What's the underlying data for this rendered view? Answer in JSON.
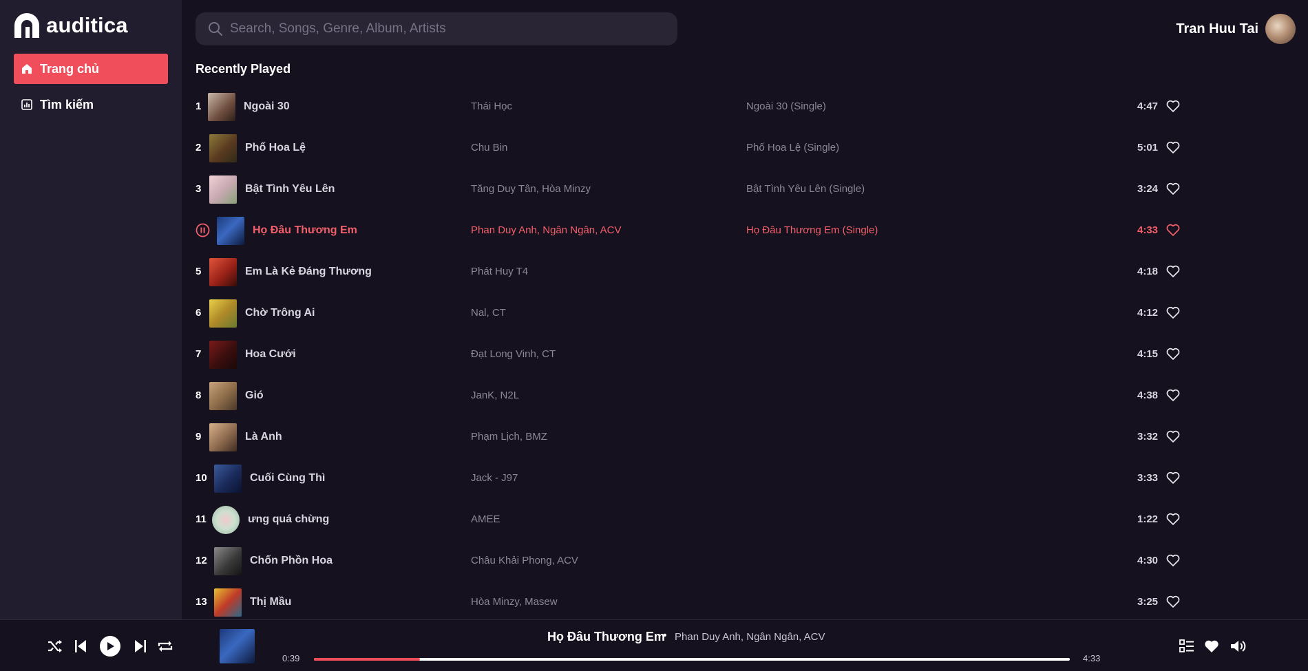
{
  "app": {
    "name": "auditica"
  },
  "colors": {
    "accent": "#ef4e5a",
    "playing": "#f25f6b",
    "background": "#15111f",
    "sidebar": "#221d2e"
  },
  "sidebar": {
    "items": [
      {
        "label": "Trang chủ",
        "icon": "home-icon",
        "active": true
      },
      {
        "label": "Tìm kiếm",
        "icon": "chart-icon",
        "active": false
      }
    ]
  },
  "search": {
    "placeholder": "Search, Songs, Genre, Album, Artists",
    "value": ""
  },
  "user": {
    "name": "Tran Huu Tai"
  },
  "section": {
    "title": "Recently Played"
  },
  "tracks": [
    {
      "num": "1",
      "title": "Ngoài 30",
      "artist": "Thái Học",
      "album": "Ngoài 30 (Single)",
      "duration": "4:47"
    },
    {
      "num": "2",
      "title": "Phố Hoa Lệ",
      "artist": "Chu Bin",
      "album": "Phố Hoa Lệ (Single)",
      "duration": "5:01"
    },
    {
      "num": "3",
      "title": "Bật Tình Yêu Lên",
      "artist": "Tăng Duy Tân, Hòa Minzy",
      "album": "Bật Tình Yêu Lên (Single)",
      "duration": "3:24"
    },
    {
      "num": "",
      "title": "Họ Đâu Thương Em",
      "artist": "Phan Duy Anh, Ngân Ngân, ACV",
      "album": "Họ Đâu Thương Em (Single)",
      "duration": "4:33",
      "playing": true
    },
    {
      "num": "5",
      "title": "Em Là Kẻ Đáng Thương",
      "artist": "Phát Huy T4",
      "album": "",
      "duration": "4:18"
    },
    {
      "num": "6",
      "title": "Chờ Trông Ai",
      "artist": "Nal, CT",
      "album": "",
      "duration": "4:12"
    },
    {
      "num": "7",
      "title": "Hoa Cưới",
      "artist": "Đạt Long Vinh, CT",
      "album": "",
      "duration": "4:15"
    },
    {
      "num": "8",
      "title": "Gió",
      "artist": "JanK, N2L",
      "album": "",
      "duration": "4:38"
    },
    {
      "num": "9",
      "title": "Là Anh",
      "artist": "Phạm Lịch, BMZ",
      "album": "",
      "duration": "3:32"
    },
    {
      "num": "10",
      "title": "Cuối Cùng Thì",
      "artist": "Jack - J97",
      "album": "",
      "duration": "3:33"
    },
    {
      "num": "11",
      "title": "ưng quá chừng",
      "artist": "AMEE",
      "album": "",
      "duration": "1:22"
    },
    {
      "num": "12",
      "title": "Chốn Phồn Hoa",
      "artist": "Châu Khải Phong, ACV",
      "album": "",
      "duration": "4:30"
    },
    {
      "num": "13",
      "title": "Thị Mầu",
      "artist": "Hòa Minzy, Masew",
      "album": "",
      "duration": "3:25"
    }
  ],
  "player": {
    "title": "Họ Đâu Thương Em",
    "separator": "•",
    "artist": "Phan Duy Anh, Ngân Ngân, ACV",
    "current_time": "0:39",
    "total_time": "4:33",
    "progress": 0.14,
    "controls": [
      "shuffle-icon",
      "previous-icon",
      "play-icon",
      "next-icon",
      "repeat-icon"
    ],
    "right_controls": [
      "queue-icon",
      "heart-icon",
      "volume-icon"
    ]
  }
}
